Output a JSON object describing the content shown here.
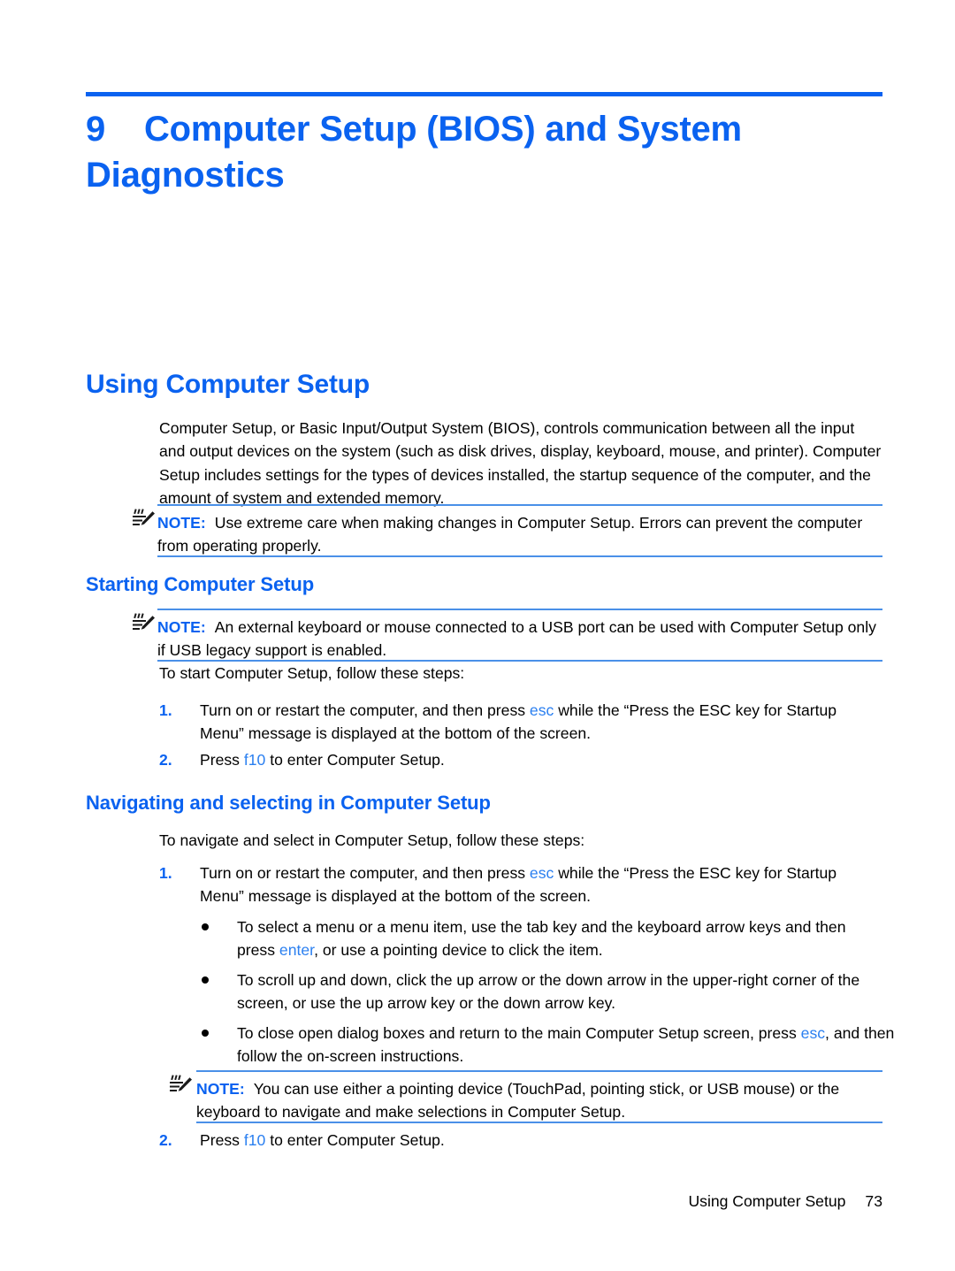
{
  "chapter": {
    "number": "9",
    "title": "Computer Setup (BIOS) and System Diagnostics"
  },
  "sections": {
    "using_computer_setup": {
      "heading": "Using Computer Setup",
      "intro": "Computer Setup, or Basic Input/Output System (BIOS), controls communication between all the input and output devices on the system (such as disk drives, display, keyboard, mouse, and printer). Computer Setup includes settings for the types of devices installed, the startup sequence of the computer, and the amount of system and extended memory.",
      "note": {
        "label": "NOTE:",
        "text": "Use extreme care when making changes in Computer Setup. Errors can prevent the computer from operating properly."
      }
    },
    "starting_computer_setup": {
      "heading": "Starting Computer Setup",
      "note": {
        "label": "NOTE:",
        "text": "An external keyboard or mouse connected to a USB port can be used with Computer Setup only if USB legacy support is enabled."
      },
      "lead_in": "To start Computer Setup, follow these steps:",
      "steps": [
        {
          "number": "1.",
          "parts": [
            {
              "text": "Turn on or restart the computer, and then press ",
              "style": "normal"
            },
            {
              "text": "esc",
              "style": "key"
            },
            {
              "text": " while the “Press the ESC key for Startup Menu” message is displayed at the bottom of the screen.",
              "style": "normal"
            }
          ]
        },
        {
          "number": "2.",
          "parts": [
            {
              "text": "Press ",
              "style": "normal"
            },
            {
              "text": "f10",
              "style": "key"
            },
            {
              "text": " to enter Computer Setup.",
              "style": "normal"
            }
          ]
        }
      ]
    },
    "navigating_and_selecting": {
      "heading": "Navigating and selecting in Computer Setup",
      "lead_in": "To navigate and select in Computer Setup, follow these steps:",
      "step1": {
        "number": "1.",
        "parts": [
          {
            "text": "Turn on or restart the computer, and then press ",
            "style": "normal"
          },
          {
            "text": "esc",
            "style": "key"
          },
          {
            "text": " while the “Press the ESC key for Startup Menu” message is displayed at the bottom of the screen.",
            "style": "normal"
          }
        ]
      },
      "bullets": [
        {
          "parts": [
            {
              "text": "To select a menu or a menu item, use the tab key and the keyboard arrow keys and then press ",
              "style": "normal"
            },
            {
              "text": "enter",
              "style": "key"
            },
            {
              "text": ", or use a pointing device to click the item.",
              "style": "normal"
            }
          ]
        },
        {
          "parts": [
            {
              "text": "To scroll up and down, click the up arrow or the down arrow in the upper-right corner of the screen, or use the up arrow key or the down arrow key.",
              "style": "normal"
            }
          ]
        },
        {
          "parts": [
            {
              "text": "To close open dialog boxes and return to the main Computer Setup screen, press ",
              "style": "normal"
            },
            {
              "text": "esc",
              "style": "key"
            },
            {
              "text": ", and then follow the on-screen instructions.",
              "style": "normal"
            }
          ]
        }
      ],
      "note": {
        "label": "NOTE:",
        "text": "You can use either a pointing device (TouchPad, pointing stick, or USB mouse) or the keyboard to navigate and make selections in Computer Setup."
      },
      "step2": {
        "number": "2.",
        "parts": [
          {
            "text": "Press ",
            "style": "normal"
          },
          {
            "text": "f10",
            "style": "key"
          },
          {
            "text": " to enter Computer Setup.",
            "style": "normal"
          }
        ]
      }
    }
  },
  "footer": {
    "section_name": "Using Computer Setup",
    "page_number": "73"
  },
  "colors": {
    "accent_blue": "#0a62f0",
    "key_blue": "#2a7ff0",
    "rule_blue": "#4a90e8"
  }
}
